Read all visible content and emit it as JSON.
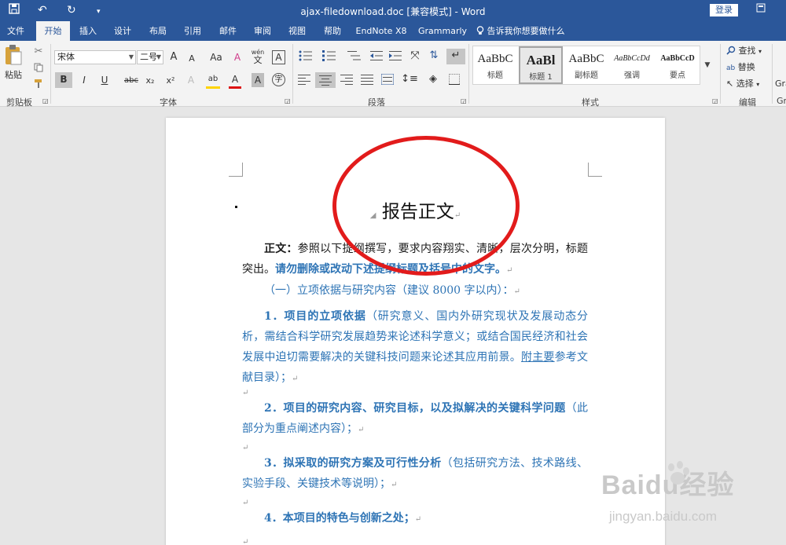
{
  "titlebar": {
    "title": "ajax-filedownload.doc [兼容模式] - Word",
    "login": "登录",
    "save_icon": "save-icon",
    "undo_icon": "undo-icon",
    "redo_icon": "redo-icon",
    "customize_icon": "customize-icon"
  },
  "tabs": [
    {
      "label": "文件"
    },
    {
      "label": "开始"
    },
    {
      "label": "插入"
    },
    {
      "label": "设计"
    },
    {
      "label": "布局"
    },
    {
      "label": "引用"
    },
    {
      "label": "邮件"
    },
    {
      "label": "审阅"
    },
    {
      "label": "视图"
    },
    {
      "label": "帮助"
    },
    {
      "label": "EndNote X8"
    },
    {
      "label": "Grammarly"
    }
  ],
  "tell_me": "告诉我你想要做什么",
  "ribbon": {
    "clipboard": {
      "label": "剪贴板",
      "paste": "粘贴"
    },
    "font": {
      "label": "字体",
      "font_name": "宋体",
      "font_size": "二号",
      "grow": "A",
      "shrink": "A",
      "case": "Aa",
      "clear": "A",
      "phonetic": "wén",
      "border": "A",
      "bold": "B",
      "italic": "I",
      "underline": "U",
      "strike": "abc",
      "subscript": "x₂",
      "superscript": "x²",
      "effects": "A",
      "highlight": "ab",
      "font_color": "A",
      "shading": "A",
      "enclose": "字"
    },
    "paragraph": {
      "label": "段落"
    },
    "styles": {
      "label": "样式",
      "items": [
        {
          "sample": "AaBbC",
          "name": "标题"
        },
        {
          "sample": "AaBl",
          "name": "标题 1"
        },
        {
          "sample": "AaBbC",
          "name": "副标题"
        },
        {
          "sample": "AaBbCcDd",
          "name": "强调"
        },
        {
          "sample": "AaBbCcD",
          "name": "要点"
        }
      ]
    },
    "editing": {
      "label": "编辑",
      "find": "查找",
      "replace": "替换",
      "select": "选择"
    },
    "grammarly": {
      "label1": "Gra",
      "label2": "Gra"
    }
  },
  "document": {
    "title": "报告正文",
    "intro_bold": "正文：",
    "intro_text": "参照以下提纲撰写，要求内容翔实、清晰，层次分明，标题突出。",
    "intro_blue": "请勿删除或改动下述提纲标题及括号中的文字。",
    "section1": "（一）立项依据与研究内容（建议 8000 字以内）：",
    "item1_bold": "1．项目的立项依据",
    "item1_text": "（研究意义、国内外研究现状及发展动态分析，需结合科学研究发展趋势来论述科学意义；或结合国民经济和社会发展中迫切需要解决的关键科技问题来论述其应用前景。",
    "item1_link": "附主要",
    "item1_tail": "参考文献目录）；",
    "item2_bold": "2．项目的研究内容、研究目标，以及拟解决的关键科学问题",
    "item2_text": "（此部分为重点阐述内容）；",
    "item3_bold": "3．拟采取的研究方案及可行性分析",
    "item3_text": "（包括研究方法、技术路线、实验手段、关键技术等说明）；",
    "item4_bold": "4．本项目的特色与创新之处；"
  },
  "watermark": {
    "brand": "Baidu经验",
    "url": "jingyan.baidu.com"
  },
  "colors": {
    "ribbon_blue": "#2b579a",
    "doc_blue": "#2e74b5",
    "circle_red": "#e21b1b"
  }
}
